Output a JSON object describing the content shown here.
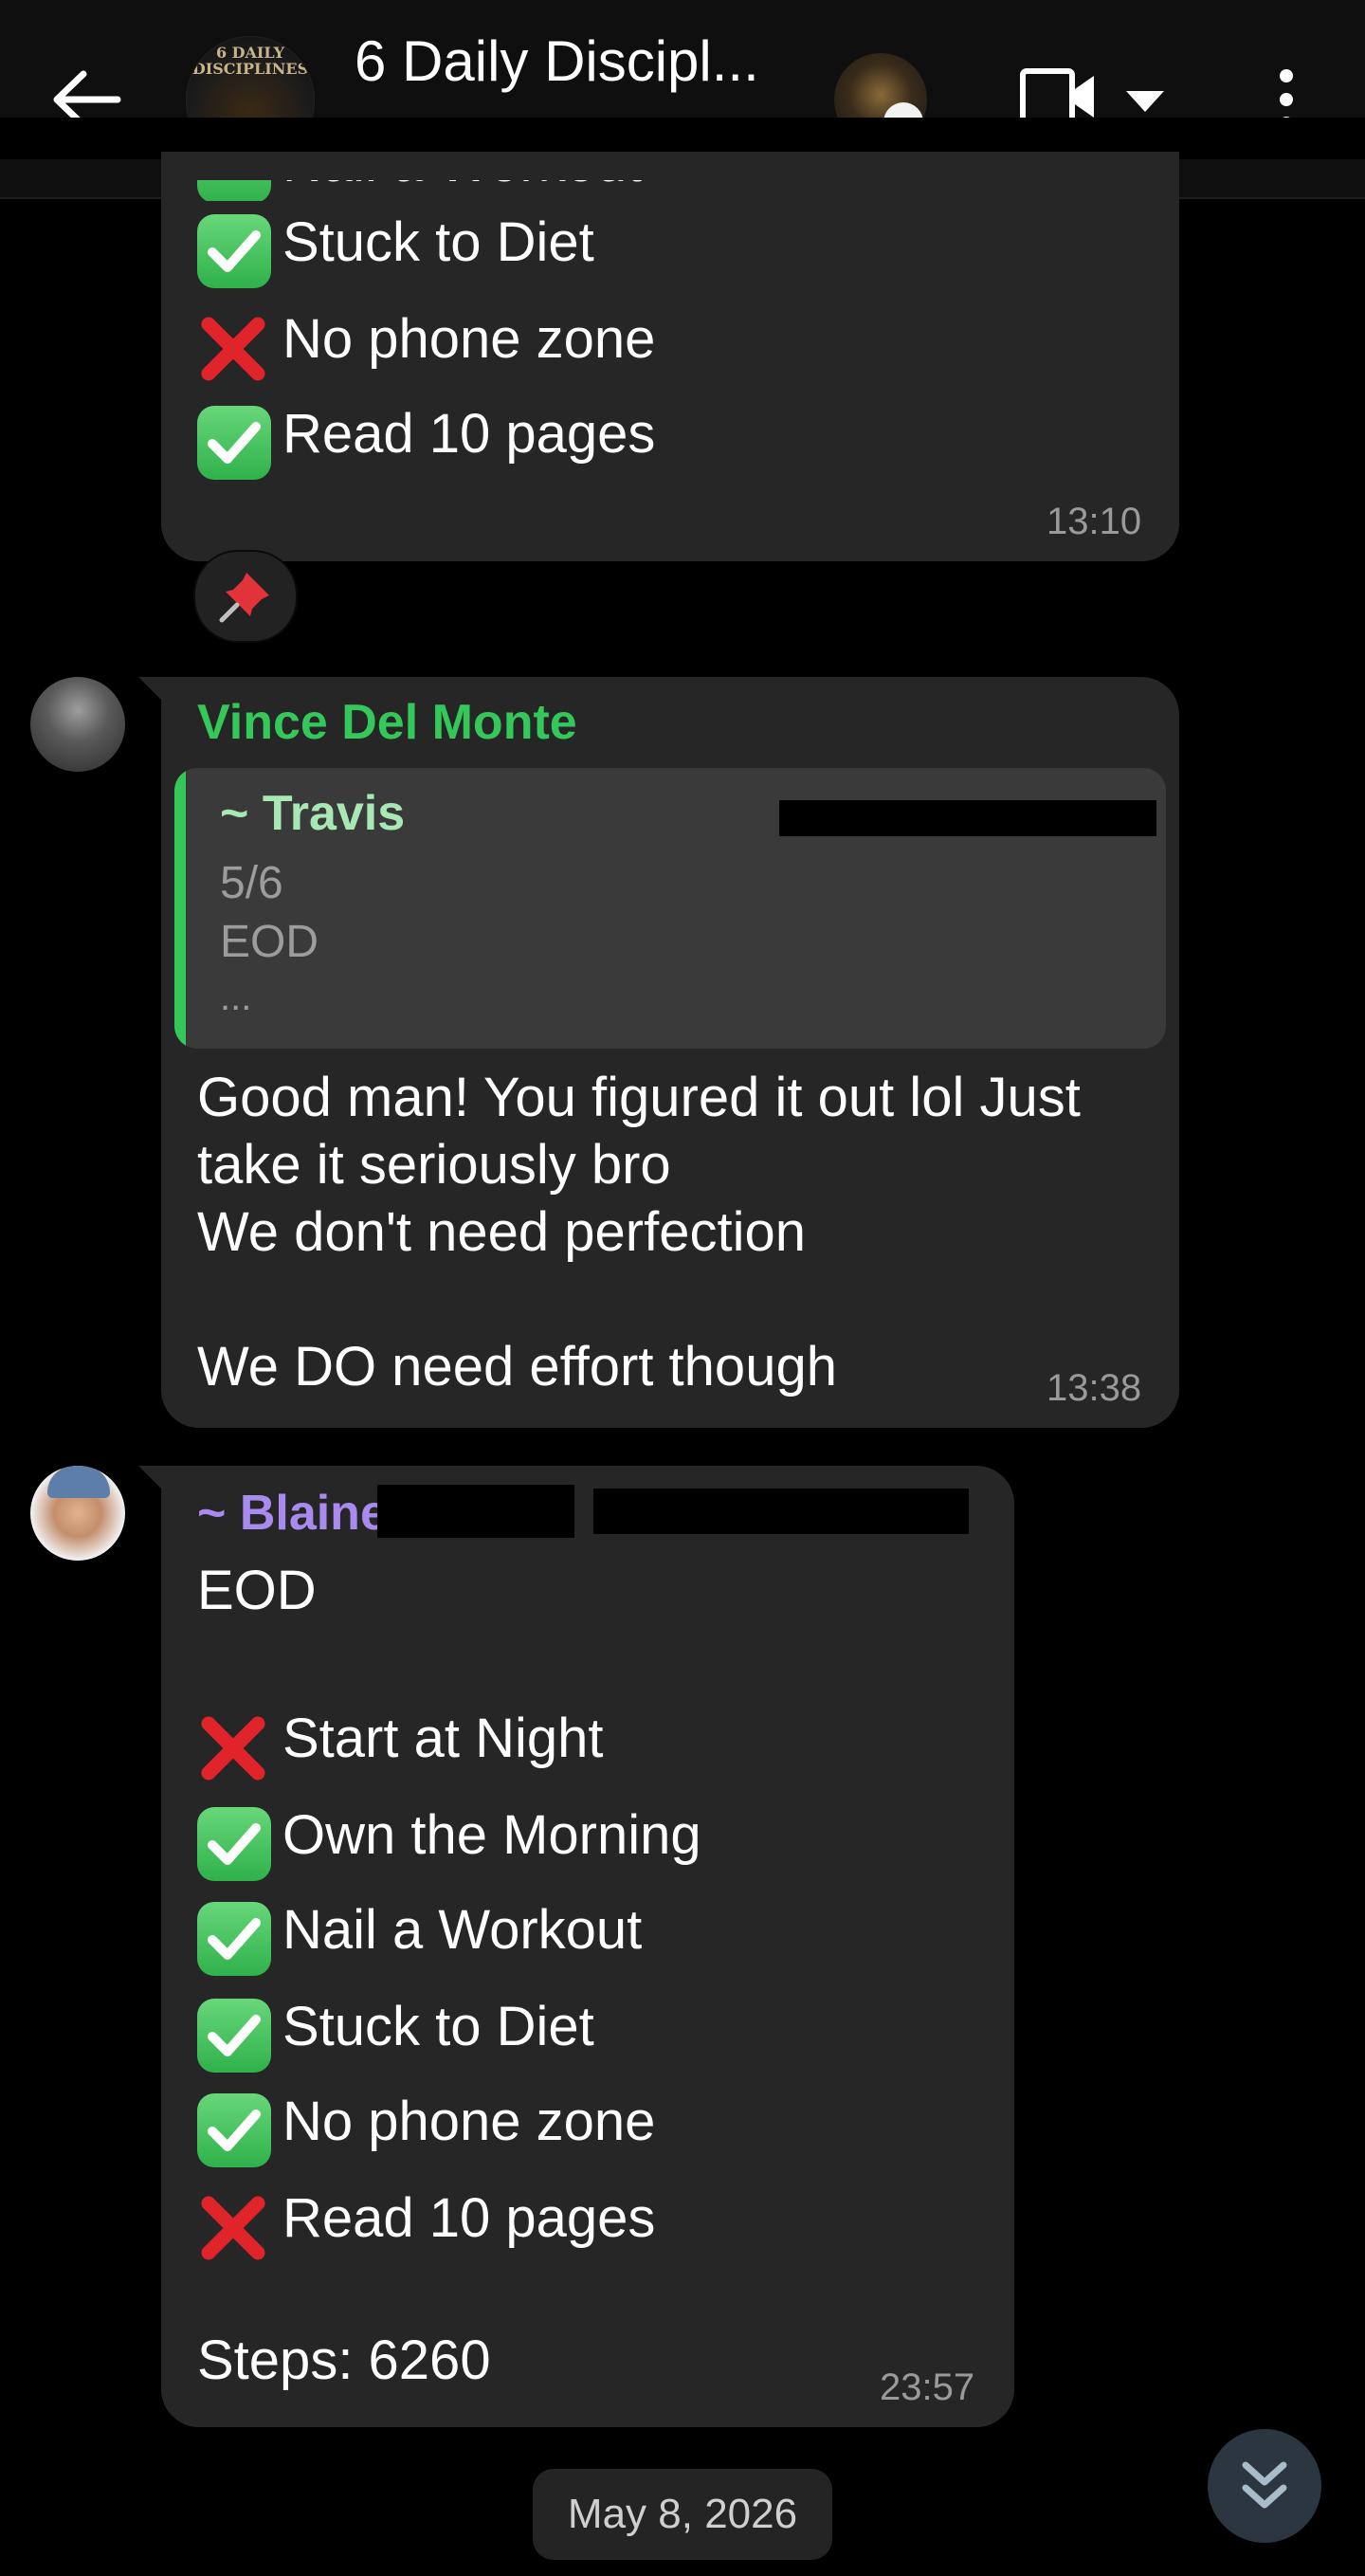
{
  "header": {
    "title": "6 Daily Discipl...",
    "group_logo_text": "6 DAILY DISCIPLINES"
  },
  "messages": [
    {
      "id": "msg1",
      "items": [
        {
          "status": "check",
          "label": "Nail a Workout"
        },
        {
          "status": "check",
          "label": "Stuck to Diet"
        },
        {
          "status": "cross",
          "label": "No phone zone"
        },
        {
          "status": "check",
          "label": "Read 10 pages"
        }
      ],
      "time": "13:10",
      "reaction": "pushpin"
    },
    {
      "id": "msg2",
      "sender": "Vince Del Monte",
      "sender_color": "#34c759",
      "quote": {
        "name": "~ Travis",
        "lines": [
          "5/6",
          "EOD",
          "..."
        ]
      },
      "text_lines": [
        "Good man! You figured it out lol Just",
        "take it seriously bro",
        "We don't need perfection",
        "",
        "We DO need effort though"
      ],
      "time": "13:38"
    },
    {
      "id": "msg3",
      "sender": "~ Blaine",
      "sender_color": "#a98bf0",
      "heading": "EOD",
      "items": [
        {
          "status": "cross",
          "label": "Start at Night"
        },
        {
          "status": "check",
          "label": "Own the Morning"
        },
        {
          "status": "check",
          "label": "Nail a Workout"
        },
        {
          "status": "check",
          "label": "Stuck to Diet"
        },
        {
          "status": "check",
          "label": "No phone zone"
        },
        {
          "status": "cross",
          "label": "Read 10 pages"
        }
      ],
      "steps": "Steps: 6260",
      "time": "23:57"
    }
  ],
  "date_chip": "May 8, 2026",
  "icons": {
    "back": "arrow-left-icon",
    "video": "video-call-icon",
    "dropdown": "caret-down-icon",
    "more": "more-vertical-icon",
    "scroll": "double-chevron-down-icon",
    "pin": "pushpin-icon"
  }
}
